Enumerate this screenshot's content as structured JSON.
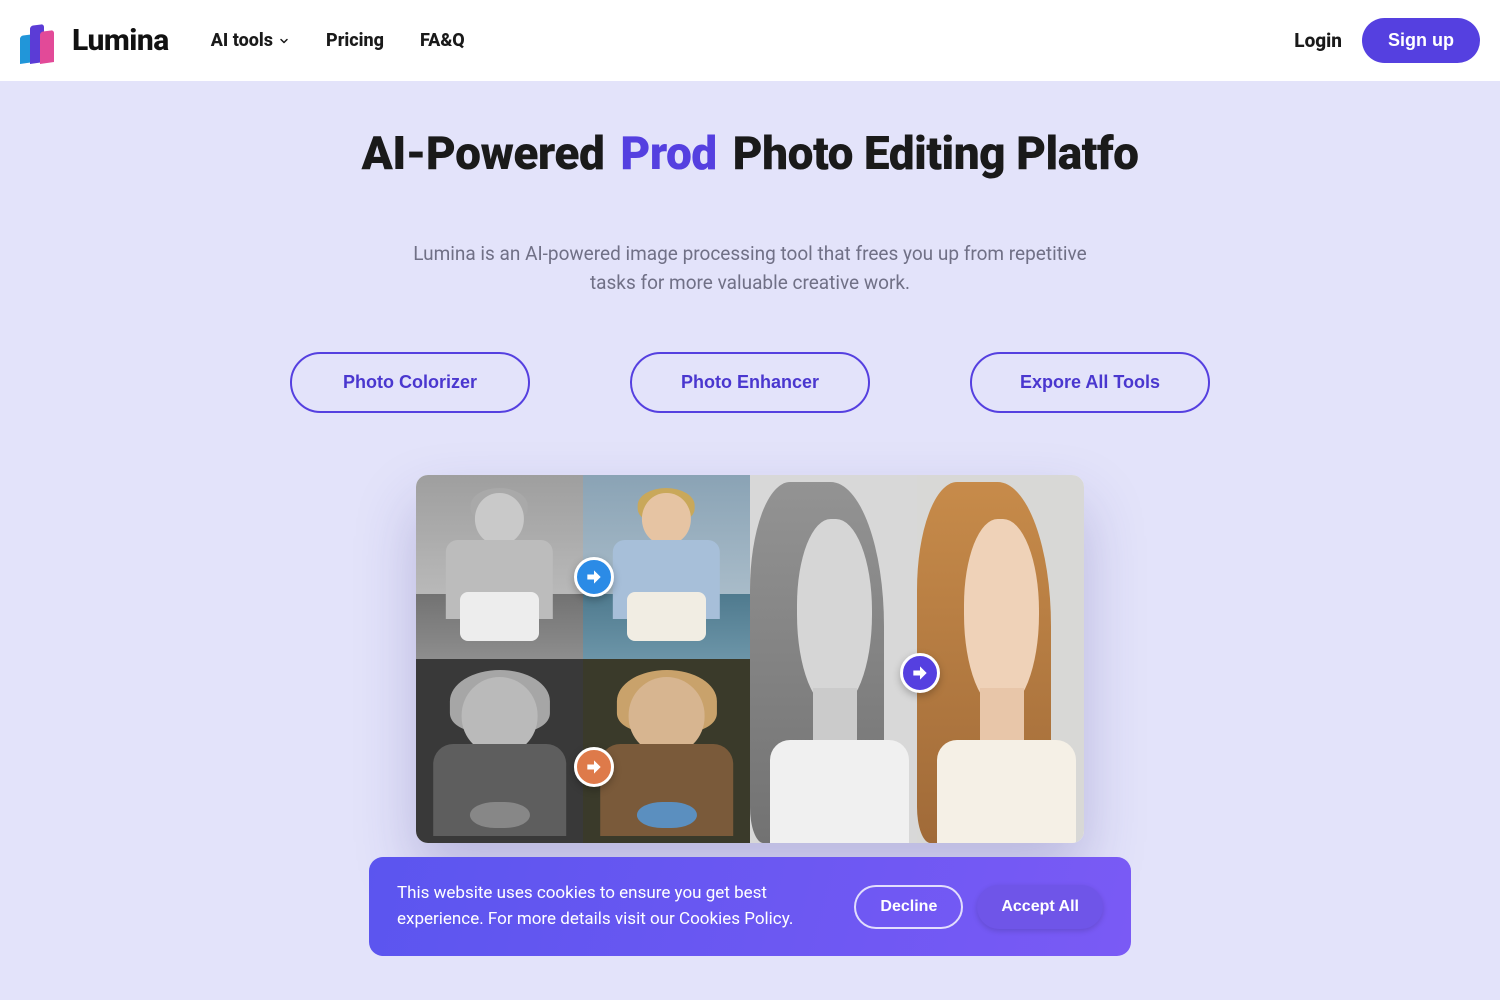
{
  "brand": {
    "name": "Lumina"
  },
  "nav": {
    "ai_tools": "AI tools",
    "pricing": "Pricing",
    "faq": "FA&Q"
  },
  "auth": {
    "login": "Login",
    "signup": "Sign up"
  },
  "hero": {
    "title_prefix": "AI-Powered",
    "title_accent": "Prod",
    "title_suffix": "Photo Editing Platfo",
    "subtitle": "Lumina is an AI-powered image processing tool that frees you up from repetitive tasks for more valuable creative work."
  },
  "cta": {
    "colorizer": "Photo Colorizer",
    "enhancer": "Photo Enhancer",
    "explore": "Expore All Tools"
  },
  "cookies": {
    "text": "This website uses cookies to ensure you get best experience. For more details visit our Cookies Policy.",
    "decline": "Decline",
    "accept": "Accept All"
  }
}
